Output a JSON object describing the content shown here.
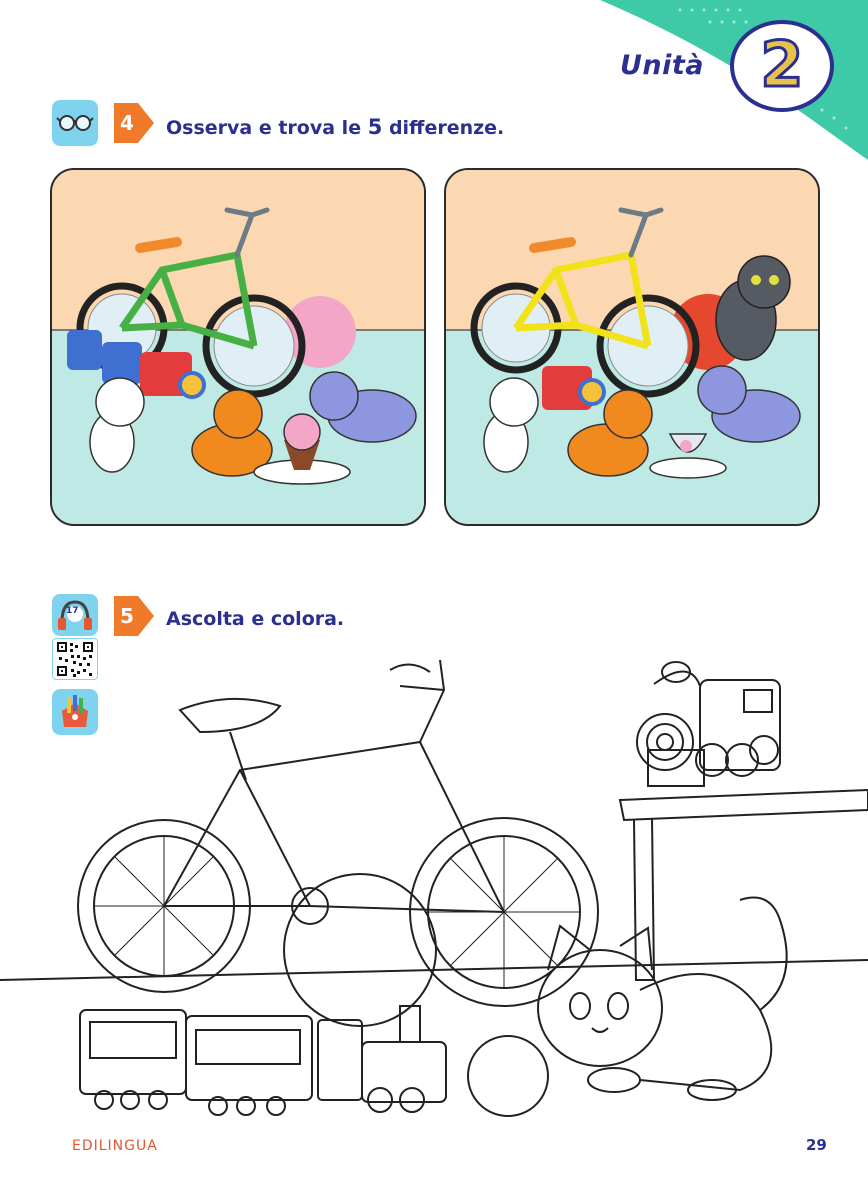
{
  "header": {
    "unit_label": "Unità",
    "unit_number": "2"
  },
  "exercise4": {
    "number": "4",
    "instruction_pre": "Osserva e trova le ",
    "instruction_num": "5",
    "instruction_post": " differenze.",
    "icon": "glasses-icon"
  },
  "exercise5": {
    "number": "5",
    "instruction": "Ascolta e colora.",
    "track_number": "17",
    "icons": [
      "headphones-icon",
      "qr-code-icon",
      "crayons-icon"
    ]
  },
  "footer": {
    "brand": "EDILINGUA",
    "page_number": "29"
  },
  "colors": {
    "title_blue": "#2b2f8f",
    "badge_orange": "#f07a2a",
    "icon_tile": "#7fd3ee",
    "wall_peach": "#fbd7b2",
    "floor_mint": "#bfe9e4",
    "corner_green": "#3fcaa7"
  }
}
